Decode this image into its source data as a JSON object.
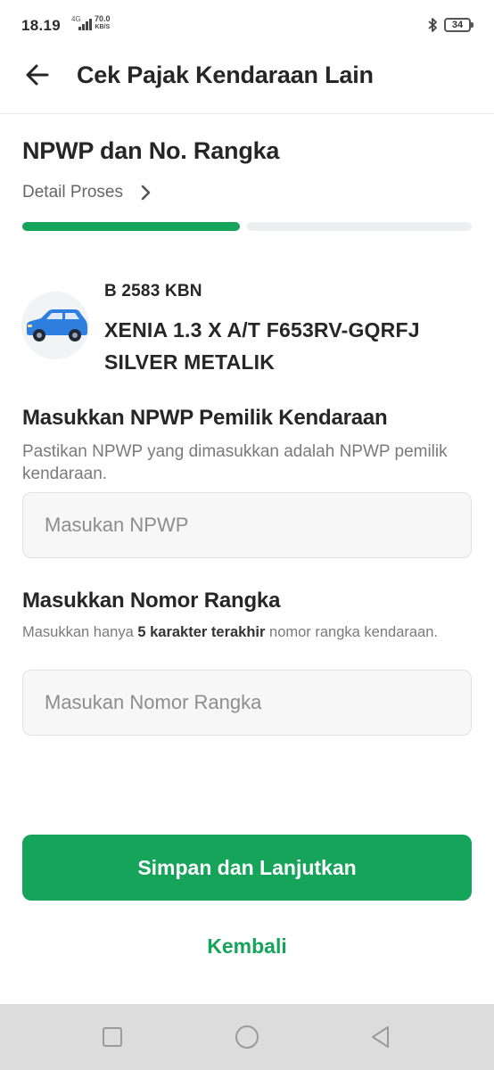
{
  "status_bar": {
    "time": "18.19",
    "network": "4G",
    "speed_value": "70.0",
    "speed_unit": "KB/S",
    "battery": "34"
  },
  "header": {
    "title": "Cek Pajak Kendaraan Lain",
    "back_icon": "arrow-left-icon"
  },
  "section": {
    "title": "NPWP dan No. Rangka",
    "detail_link": "Detail Proses",
    "progress": {
      "current_step": 1,
      "total_steps": 2
    }
  },
  "vehicle": {
    "icon": "car-icon",
    "plate": "B 2583 KBN",
    "name": "XENIA 1.3 X A/T F653RV-GQRFJ SILVER METALIK",
    "icon_color": "#2f7fe0"
  },
  "npwp_field": {
    "label": "Masukkan NPWP Pemilik Kendaraan",
    "hint": "Pastikan NPWP yang dimasukkan adalah NPWP pemilik kendaraan.",
    "placeholder": "Masukan NPWP",
    "value": ""
  },
  "rangka_field": {
    "label": "Masukkan Nomor Rangka",
    "hint_prefix": "Masukkan hanya ",
    "hint_bold": "5 karakter terakhir",
    "hint_suffix": " nomor rangka kendaraan.",
    "placeholder": "Masukan Nomor Rangka",
    "value": ""
  },
  "actions": {
    "primary_label": "Simpan dan Lanjutkan",
    "secondary_label": "Kembali"
  },
  "colors": {
    "primary": "#16a35a",
    "progress_inactive": "#eceeef"
  },
  "nav_bar": {
    "icons": [
      "recent-apps-icon",
      "home-icon",
      "back-triangle-icon"
    ]
  }
}
